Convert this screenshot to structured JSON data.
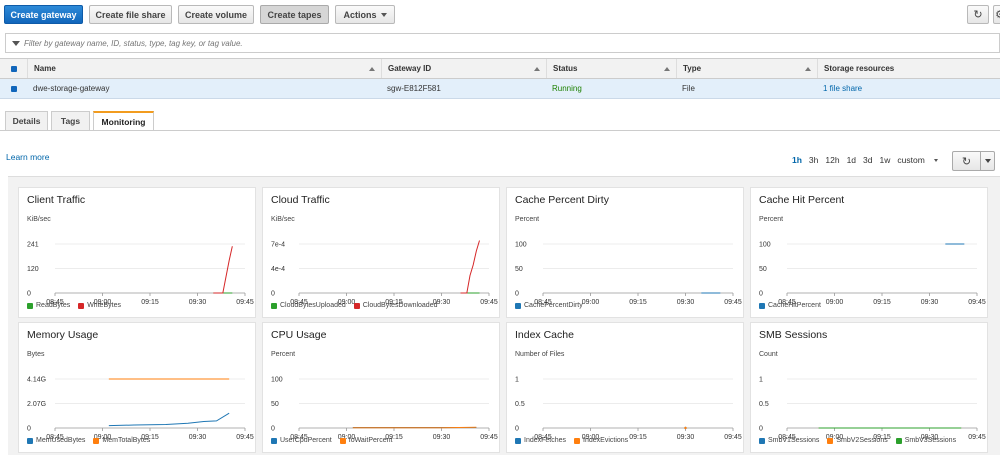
{
  "toolbar": {
    "create_gateway": "Create gateway",
    "create_file_share": "Create file share",
    "create_volume": "Create volume",
    "create_tapes": "Create tapes",
    "actions": "Actions",
    "refresh_icon": "refresh-icon",
    "settings_icon": "gear-icon"
  },
  "filter": {
    "placeholder": "Filter by gateway name, ID, status, type, tag key, or tag value."
  },
  "table": {
    "columns": [
      "Name",
      "Gateway ID",
      "Status",
      "Type",
      "Storage resources"
    ],
    "rows": [
      {
        "name": "dwe-storage-gateway",
        "gateway_id": "sgw-E812F581",
        "status": "Running",
        "type": "File",
        "storage": "1 file share"
      }
    ]
  },
  "tabs": [
    "Details",
    "Tags",
    "Monitoring"
  ],
  "active_tab": "Monitoring",
  "learn_more": "Learn more",
  "time_ranges": [
    "1h",
    "3h",
    "12h",
    "1d",
    "3d",
    "1w",
    "custom"
  ],
  "selected_range": "1h",
  "colors": {
    "primary": "#1166bb",
    "running": "#1d8102",
    "tab_accent": "#f29c1f"
  },
  "x_ticks": [
    "08:45",
    "09:00",
    "09:15",
    "09:30",
    "09:45"
  ],
  "chart_data": [
    {
      "type": "line",
      "title": "Client Traffic",
      "ylabel": "KiB/sec",
      "y_ticks": [
        "241",
        "120",
        "0"
      ],
      "ylim": [
        0,
        241
      ],
      "x": [
        "09:35",
        "09:36",
        "09:37",
        "09:38",
        "09:39",
        "09:40",
        "09:41"
      ],
      "series": [
        {
          "name": "ReadBytes",
          "color": "#2ca02c",
          "values": [
            0,
            0,
            0,
            0,
            0,
            0,
            0
          ]
        },
        {
          "name": "WriteBytes",
          "color": "#d62728",
          "values": [
            0,
            0,
            0,
            0,
            80,
            160,
            230
          ]
        }
      ]
    },
    {
      "type": "line",
      "title": "Cloud Traffic",
      "ylabel": "KiB/sec",
      "y_ticks": [
        "7e-4",
        "4e-4",
        "0"
      ],
      "ylim": [
        0,
        0.0007
      ],
      "x": [
        "09:36",
        "09:37",
        "09:38",
        "09:39",
        "09:40",
        "09:41",
        "09:42"
      ],
      "series": [
        {
          "name": "CloudBytesUploaded",
          "color": "#2ca02c",
          "values": [
            0,
            0,
            0,
            0,
            0,
            0,
            0
          ]
        },
        {
          "name": "CloudBytesDownloaded",
          "color": "#d62728",
          "values": [
            0,
            0,
            0,
            0.00025,
            0.0004,
            0.0006,
            0.00075
          ]
        }
      ]
    },
    {
      "type": "line",
      "title": "Cache Percent Dirty",
      "ylabel": "Percent",
      "y_ticks": [
        "100",
        "50",
        "0"
      ],
      "ylim": [
        0,
        100
      ],
      "x": [
        "09:35",
        "09:37",
        "09:39",
        "09:41"
      ],
      "series": [
        {
          "name": "CachePercentDirty",
          "color": "#1f77b4",
          "values": [
            0,
            0,
            0,
            0
          ]
        }
      ]
    },
    {
      "type": "line",
      "title": "Cache Hit Percent",
      "ylabel": "Percent",
      "y_ticks": [
        "100",
        "50",
        "0"
      ],
      "ylim": [
        0,
        100
      ],
      "x": [
        "09:35",
        "09:37",
        "09:39",
        "09:41"
      ],
      "series": [
        {
          "name": "CacheHitPercent",
          "color": "#1f77b4",
          "values": [
            100,
            100,
            100,
            100
          ]
        }
      ]
    },
    {
      "type": "line",
      "title": "Memory Usage",
      "ylabel": "Bytes",
      "y_ticks": [
        "4.14G",
        "2.07G",
        "0"
      ],
      "ylim": [
        0,
        4.14
      ],
      "x": [
        "09:02",
        "09:10",
        "09:20",
        "09:27",
        "09:32",
        "09:36",
        "09:40"
      ],
      "series": [
        {
          "name": "MemUsedBytes",
          "color": "#1f77b4",
          "values": [
            0.2,
            0.25,
            0.3,
            0.4,
            0.55,
            0.6,
            1.25
          ]
        },
        {
          "name": "MemTotalBytes",
          "color": "#ff7f0e",
          "values": [
            4.14,
            4.14,
            4.14,
            4.14,
            4.14,
            4.14,
            4.14
          ]
        }
      ]
    },
    {
      "type": "line",
      "title": "CPU Usage",
      "ylabel": "Percent",
      "y_ticks": [
        "100",
        "50",
        "0"
      ],
      "ylim": [
        0,
        100
      ],
      "x": [
        "09:02",
        "09:15",
        "09:30",
        "09:41"
      ],
      "series": [
        {
          "name": "UserCpuPercent",
          "color": "#1f77b4",
          "values": [
            1,
            1,
            1,
            1
          ]
        },
        {
          "name": "IoWaitPercent",
          "color": "#ff7f0e",
          "values": [
            0.5,
            0.5,
            0.5,
            1.5
          ]
        }
      ]
    },
    {
      "type": "line",
      "title": "Index Cache",
      "ylabel": "Number of Files",
      "y_ticks": [
        "1",
        "0.5",
        "0"
      ],
      "ylim": [
        0,
        1
      ],
      "x": [
        "09:30"
      ],
      "series": [
        {
          "name": "IndexFetches",
          "color": "#1f77b4",
          "values": [
            0
          ]
        },
        {
          "name": "IndexEvictions",
          "color": "#ff7f0e",
          "values": [
            0
          ]
        }
      ]
    },
    {
      "type": "line",
      "title": "SMB Sessions",
      "ylabel": "Count",
      "y_ticks": [
        "1",
        "0.5",
        "0"
      ],
      "ylim": [
        0,
        1
      ],
      "x": [
        "08:55",
        "09:15",
        "09:40"
      ],
      "series": [
        {
          "name": "SmbV1Sessions",
          "color": "#1f77b4",
          "values": [
            0,
            0,
            0
          ]
        },
        {
          "name": "SmbV2Sessions",
          "color": "#ff7f0e",
          "values": [
            0,
            0,
            0
          ]
        },
        {
          "name": "SmbV3Sessions",
          "color": "#2ca02c",
          "values": [
            0,
            0,
            0
          ]
        }
      ]
    }
  ]
}
